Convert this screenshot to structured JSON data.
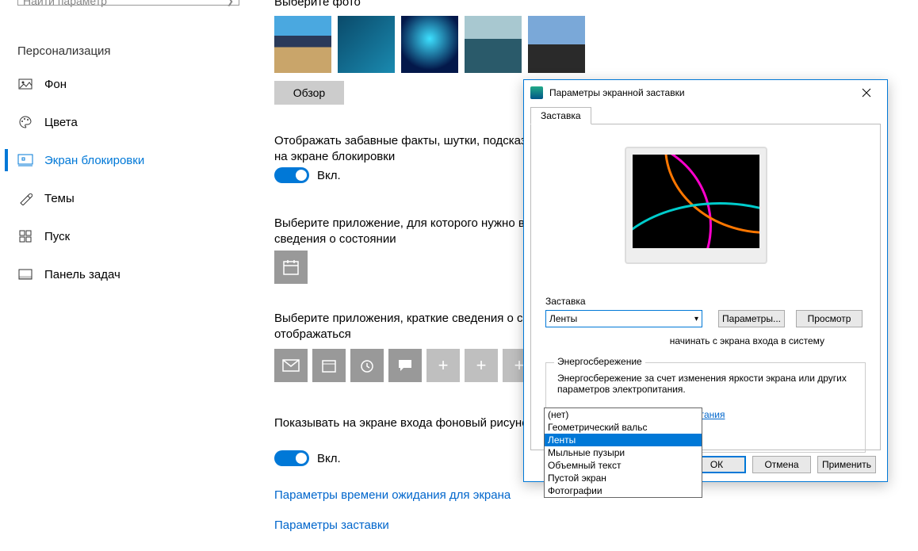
{
  "search": {
    "placeholder": "Найти параметр"
  },
  "section_title": "Персонализация",
  "nav": {
    "items": [
      {
        "label": "Фон"
      },
      {
        "label": "Цвета"
      },
      {
        "label": "Экран блокировки"
      },
      {
        "label": "Темы"
      },
      {
        "label": "Пуск"
      },
      {
        "label": "Панель задач"
      }
    ]
  },
  "main": {
    "choose_photo_label": "Выберите фото",
    "browse_label": "Обзор",
    "fun_facts_label": "Отображать забавные факты, шутки, подсказки и другую информацию на экране блокировки",
    "toggle1_state": "Вкл.",
    "detail_app_label": "Выберите приложение, для которого нужно выводить подробные сведения о состоянии",
    "quick_apps_label": "Выберите приложения, краткие сведения о состоянии которых будут отображаться",
    "signin_bg_label": "Показывать на экране входа фоновый рисунок экрана блокировки",
    "toggle2_state": "Вкл.",
    "timeout_link": "Параметры времени ожидания для экрана",
    "screensaver_link": "Параметры заставки"
  },
  "dialog": {
    "title": "Параметры экранной заставки",
    "tab": "Заставка",
    "field_label": "Заставка",
    "selected": "Ленты",
    "params_btn": "Параметры...",
    "preview_btn": "Просмотр",
    "wait_suffix": "начинать с экрана входа в систему",
    "pm_legend": "Энергосбережение",
    "pm_text": "Энергосбережение за счет изменения яркости экрана или других параметров электропитания.",
    "pm_link": "Изменить параметры электропитания",
    "ok": "ОК",
    "cancel": "Отмена",
    "apply": "Применить",
    "options": [
      "(нет)",
      "Геометрический вальс",
      "Ленты",
      "Мыльные пузыри",
      "Объемный текст",
      "Пустой экран",
      "Фотографии"
    ]
  }
}
